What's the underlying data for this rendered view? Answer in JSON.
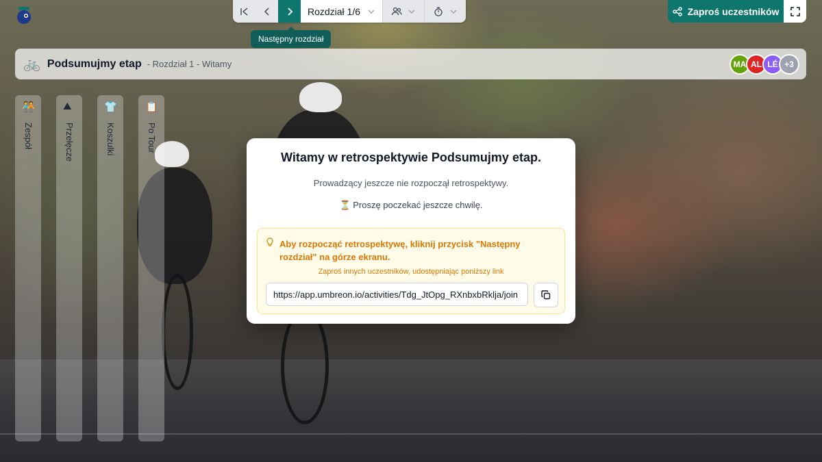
{
  "toolbar": {
    "first_icon": "skip-to-start-icon",
    "prev_icon": "chevron-left-icon",
    "next_icon": "chevron-right-icon",
    "chapter_label": "Rozdział 1/6",
    "participants_icon": "users-icon",
    "timer_icon": "timer-icon",
    "tooltip": "Następny rozdział",
    "invite_label": "Zaproś uczestników",
    "share_icon": "share-icon",
    "fullscreen_icon": "fullscreen-icon"
  },
  "header": {
    "icon": "bicycle-icon",
    "title": "Podsumujmy etap",
    "subtitle": "- Rozdział 1 - Witamy",
    "avatars": [
      {
        "label": "MA",
        "color": "#65a30d"
      },
      {
        "label": "AL",
        "color": "#dc2626"
      },
      {
        "label": "LÉ",
        "color": "#8b5cf6"
      },
      {
        "label": "+3",
        "color": "#9ca3af"
      }
    ]
  },
  "columns": [
    {
      "label": "Zespół",
      "icon": "team-icon"
    },
    {
      "label": "Przełęcze",
      "icon": "mountain-icon"
    },
    {
      "label": "Koszulki",
      "icon": "jersey-icon"
    },
    {
      "label": "Po Tour",
      "icon": "post-tour-icon"
    }
  ],
  "modal": {
    "title": "Witamy w retrospektywie Podsumujmy etap.",
    "line1": "Prowadzący jeszcze nie rozpoczął retrospektywy.",
    "line2": "⏳ Proszę poczekać jeszcze chwilę.",
    "alert": "Aby rozpocząć retrospektywę, kliknij przycisk \"Następny rozdział\" na górze ekranu.",
    "hint": "Zaproś innych uczestników, udostępniając poniższy link",
    "link": "https://app.umbreon.io/activities/Tdg_JtOpg_RXnbxbRklja/join",
    "copy_icon": "copy-icon"
  },
  "colors": {
    "accent": "#0f766e",
    "warning": "#d97706"
  }
}
